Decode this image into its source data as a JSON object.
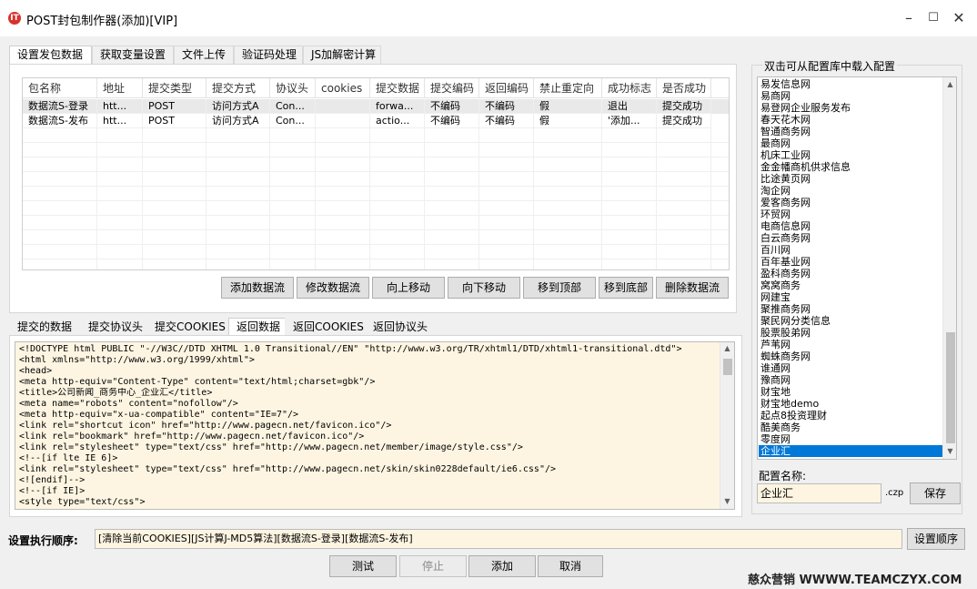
{
  "window": {
    "title": "POST封包制作器(添加)[VIP]",
    "icon_glyph": "IT",
    "minimize_glyph": "–",
    "maximize_glyph": "☐",
    "close_glyph": "✕"
  },
  "top_tabs": [
    "设置发包数据",
    "获取变量设置",
    "文件上传",
    "验证码处理",
    "JS加解密计算"
  ],
  "table": {
    "columns": [
      "包名称",
      "地址",
      "提交类型",
      "提交方式",
      "协议头",
      "cookies",
      "提交数据",
      "提交编码",
      "返回编码",
      "禁止重定向",
      "成功标志",
      "是否成功"
    ],
    "rows": [
      [
        "数据流S-登录",
        "htt...",
        "POST",
        "访问方式A",
        "Con...",
        "",
        "forwa...",
        "不编码",
        "不编码",
        "假",
        "退出",
        "提交成功"
      ],
      [
        "数据流S-发布",
        "htt...",
        "POST",
        "访问方式A",
        "Con...",
        "",
        "actio...",
        "不编码",
        "不编码",
        "假",
        "'添加...",
        "提交成功"
      ]
    ]
  },
  "table_buttons": [
    "添加数据流",
    "修改数据流",
    "向上移动",
    "向下移动",
    "移到顶部",
    "移到底部",
    "删除数据流"
  ],
  "bottom_tabs": [
    "提交的数据",
    "提交协议头",
    "提交COOKIES",
    "返回数据",
    "返回COOKIES",
    "返回协议头"
  ],
  "code_lines": [
    "<!DOCTYPE html PUBLIC \"-//W3C//DTD XHTML 1.0 Transitional//EN\" \"http://www.w3.org/TR/xhtml1/DTD/xhtml1-transitional.dtd\">",
    "<html xmlns=\"http://www.w3.org/1999/xhtml\">",
    "<head>",
    "<meta http-equiv=\"Content-Type\" content=\"text/html;charset=gbk\"/>",
    "<title>公司新闻_商务中心_企业汇</title>",
    "<meta name=\"robots\" content=\"nofollow\"/>",
    "<meta http-equiv=\"x-ua-compatible\" content=\"IE=7\"/>",
    "<link rel=\"shortcut icon\" href=\"http://www.pagecn.net/favicon.ico\"/>",
    "<link rel=\"bookmark\" href=\"http://www.pagecn.net/favicon.ico\"/>",
    "<link rel=\"stylesheet\" type=\"text/css\" href=\"http://www.pagecn.net/member/image/style.css\"/>",
    "<!--[if lte IE 6]>",
    "<link rel=\"stylesheet\" type=\"text/css\" href=\"http://www.pagecn.net/skin/skin0228default/ie6.css\"/>",
    "<![endif]-->",
    "<!--[if IE]>",
    "<style type=\"text/css\">"
  ],
  "config_library": {
    "title": "双击可从配置库中载入配置",
    "items": [
      "易发信息网",
      "易商网",
      "易登网企业服务发布",
      "春天花木网",
      "智通商务网",
      "最商网",
      "机床工业网",
      "金金幡商机供求信息",
      "比途黄页网",
      "淘企网",
      "爱客商务网",
      "环贸网",
      "电商信息网",
      "白云商务网",
      "百川网",
      "百年基业网",
      "盈科商务网",
      "窝窝商务",
      "网建宝",
      "聚推商务网",
      "聚民网分类信息",
      "股票股弟网",
      "芦苇网",
      "蜘蛛商务网",
      "谁通网",
      "豫商网",
      "财宝地",
      "财宝地demo",
      "起点8投资理财",
      "酷美商务",
      "零度网",
      "企业汇"
    ],
    "selected": "企业汇",
    "name_label": "配置名称:",
    "name_value": "企业汇",
    "extension": ".czp",
    "save_label": "保存"
  },
  "exec_order": {
    "label": "设置执行顺序:",
    "value": "[清除当前COOKIES][JS计算J-MD5算法][数据流S-登录][数据流S-发布]",
    "button": "设置顺序"
  },
  "footer_buttons": {
    "test": "测试",
    "stop": "停止",
    "add": "添加",
    "cancel": "取消"
  },
  "watermark": "慈众营销 WWWW.TEAMCZYX.COM"
}
